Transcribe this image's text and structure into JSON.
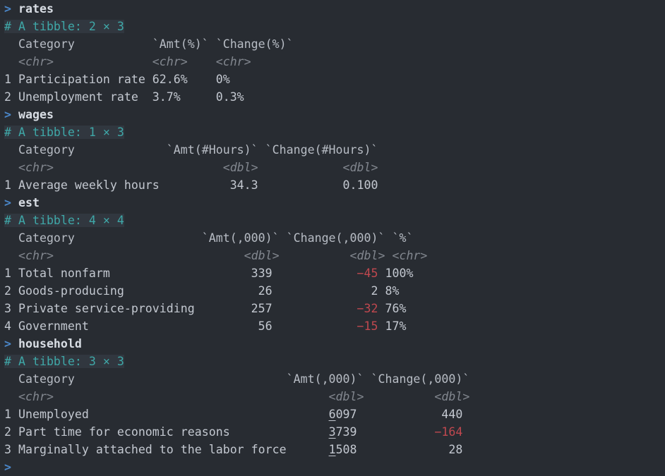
{
  "terminal": {
    "app": "R console",
    "background_color": "#282c32",
    "prompt_symbol": ">",
    "colors": {
      "prompt": "#4a86c8",
      "command": "#d8dde4",
      "tibble_header": "#3fa8a8",
      "tibble_header_bg": "#31373f",
      "column_header": "#b7bcc4",
      "column_type": "#82878f",
      "row_number": "#7e838b",
      "value": "#c3c8d0",
      "negative_value": "#c0484f"
    }
  },
  "blocks": [
    {
      "command": "rates",
      "tibble_summary": "# A tibble: 2 × 3",
      "columns": [
        "Category",
        "`Amt(%)`",
        "`Change(%)`"
      ],
      "types": [
        "<chr>",
        "<chr>",
        "<chr>"
      ],
      "rows": [
        {
          "n": "1",
          "category": "Participation rate",
          "amt": "62.6%",
          "change": "0%"
        },
        {
          "n": "2",
          "category": "Unemployment rate",
          "amt": "3.7%",
          "change": "0.3%"
        }
      ]
    },
    {
      "command": "wages",
      "tibble_summary": "# A tibble: 1 × 3",
      "columns": [
        "Category",
        "`Amt(#Hours)`",
        "`Change(#Hours)`"
      ],
      "types": [
        "<chr>",
        "<dbl>",
        "<dbl>"
      ],
      "rows": [
        {
          "n": "1",
          "category": "Average weekly hours",
          "amt": "34.3",
          "change": "0.100"
        }
      ]
    },
    {
      "command": "est",
      "tibble_summary": "# A tibble: 4 × 4",
      "columns": [
        "Category",
        "`Amt(,000)`",
        "`Change(,000)`",
        "`%`"
      ],
      "types": [
        "<chr>",
        "<dbl>",
        "<dbl>",
        "<chr>"
      ],
      "rows": [
        {
          "n": "1",
          "category": "Total nonfarm",
          "amt": "339",
          "change": "−45",
          "change_negative": true,
          "pct": "100%"
        },
        {
          "n": "2",
          "category": "Goods-producing",
          "amt": "26",
          "change": "2",
          "change_negative": false,
          "pct": "8%"
        },
        {
          "n": "3",
          "category": "Private service-providing",
          "amt": "257",
          "change": "−32",
          "change_negative": true,
          "pct": "76%"
        },
        {
          "n": "4",
          "category": "Government",
          "amt": "56",
          "change": "−15",
          "change_negative": true,
          "pct": "17%"
        }
      ]
    },
    {
      "command": "household",
      "tibble_summary": "# A tibble: 3 × 3",
      "columns": [
        "Category",
        "`Amt(,000)`",
        "`Change(,000)`"
      ],
      "types": [
        "<chr>",
        "<dbl>",
        "<dbl>"
      ],
      "rows": [
        {
          "n": "1",
          "category": "Unemployed",
          "amt_group": "6",
          "amt_rest": "097",
          "change": "440",
          "change_negative": false
        },
        {
          "n": "2",
          "category": "Part time for economic reasons",
          "amt_group": "3",
          "amt_rest": "739",
          "change": "−164",
          "change_negative": true
        },
        {
          "n": "3",
          "category": "Marginally attached to the labor force",
          "amt_group": "1",
          "amt_rest": "508",
          "change": "28",
          "change_negative": false
        }
      ]
    }
  ],
  "trailing_prompt": ">",
  "lines": {
    "b0_cmd": {
      "pre": "> ",
      "cmd": "rates"
    },
    "b0_hdr": "  Category           `Amt(%)` `Change(%)`",
    "b0_type": "  <chr>              <chr>    <chr>      ",
    "b0_r1": "1 Participation rate 62.6%    0%         ",
    "b0_r2": "2 Unemployment rate  3.7%     0.3%       ",
    "b1_cmd": {
      "pre": "> ",
      "cmd": "wages"
    },
    "b1_hdr": "  Category             `Amt(#Hours)` `Change(#Hours)`",
    "b1_type": "  <chr>                        <dbl>            <dbl>",
    "b1_r1": "1 Average weekly hours          34.3            0.100",
    "b2_cmd": {
      "pre": "> ",
      "cmd": "est"
    },
    "b2_hdr": "  Category                  `Amt(,000)` `Change(,000)` `%`  ",
    "b2_type": "  <chr>                           <dbl>          <dbl> <chr>",
    "b2_r1a": "1 Total nonfarm                    339            ",
    "b2_r1b": "−45",
    "b2_r1c": " 100%",
    "b2_r2a": "2 Goods-producing                   26              ",
    "b2_r2b": "2",
    "b2_r2c": " 8%",
    "b2_r3a": "3 Private service-providing        257            ",
    "b2_r3b": "−32",
    "b2_r3c": " 76%",
    "b2_r4a": "4 Government                        56            ",
    "b2_r4b": "−15",
    "b2_r4c": " 17%",
    "b3_cmd": {
      "pre": "> ",
      "cmd": "household"
    },
    "b3_hdr": "  Category                              `Amt(,000)` `Change(,000)`",
    "b3_type": "  <chr>                                       <dbl>          <dbl>",
    "b3_r1a": "1 Unemployed                                  ",
    "b3_r1g": "6",
    "b3_r1b": "097            440",
    "b3_r2a": "2 Part time for economic reasons              ",
    "b3_r2g": "3",
    "b3_r2b1": "739           ",
    "b3_r2b2": "−164",
    "b3_r3a": "3 Marginally attached to the labor force      ",
    "b3_r3g": "1",
    "b3_r3b": "508             28"
  }
}
